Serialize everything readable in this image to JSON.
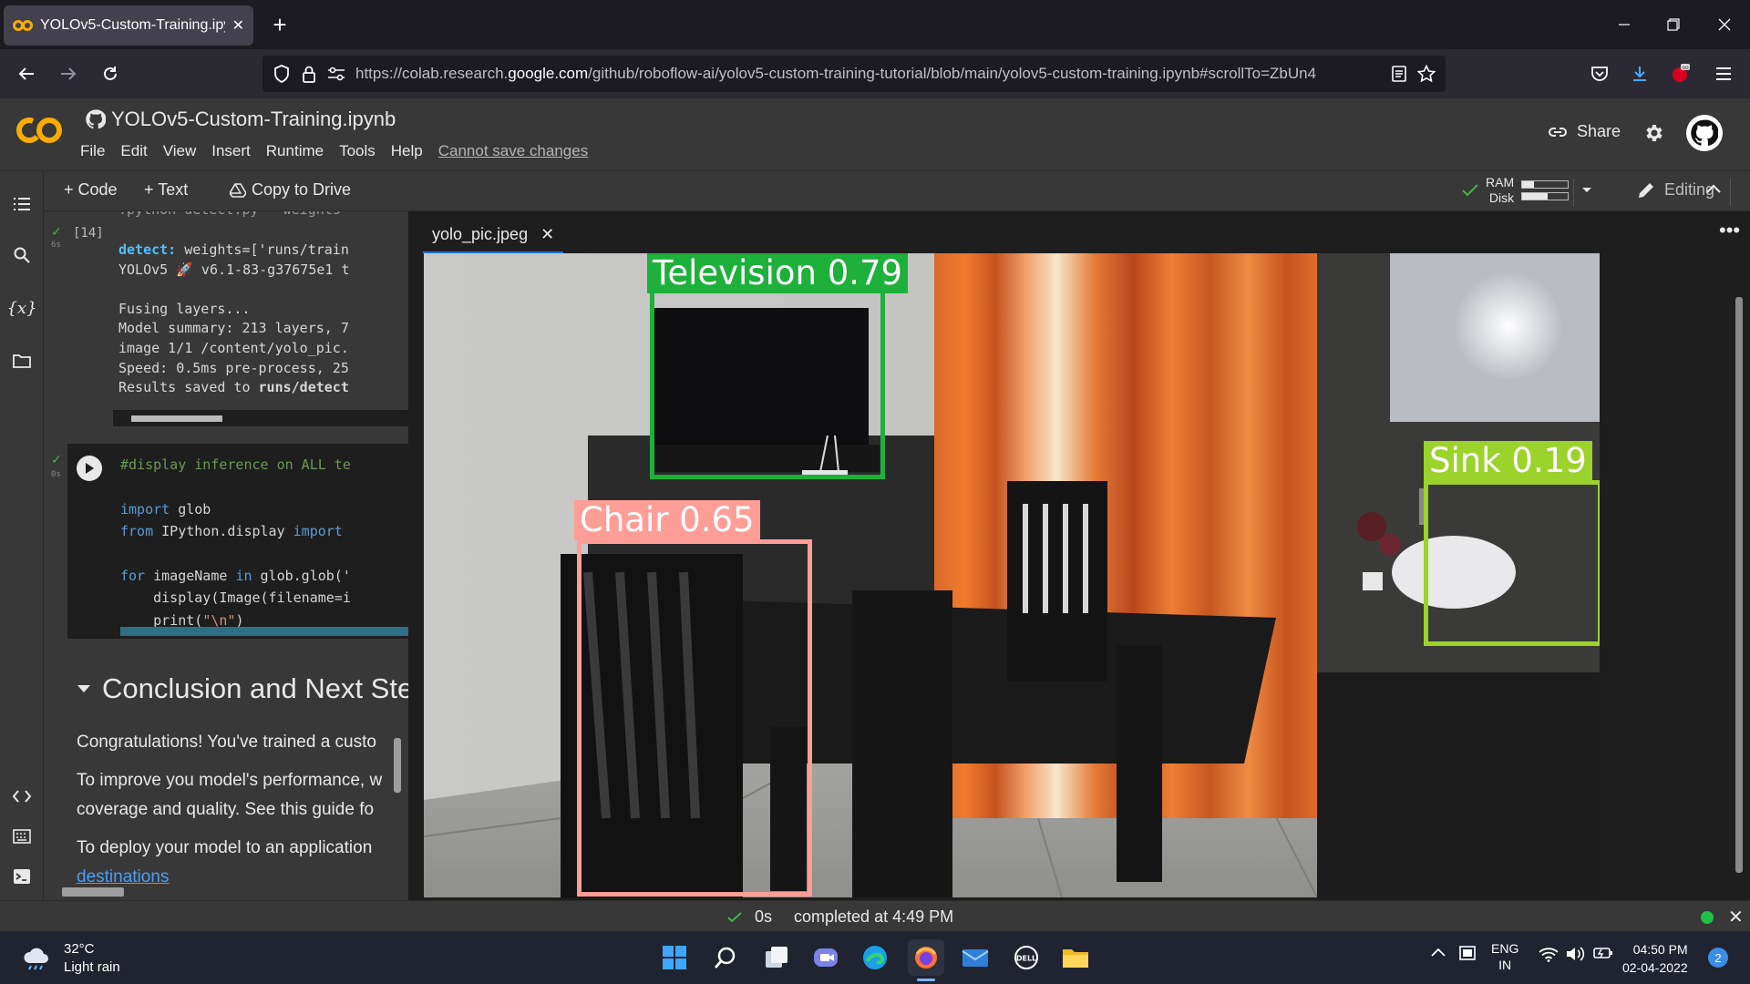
{
  "browser": {
    "tab_title": "YOLOv5-Custom-Training.ipynb",
    "url_prefix": "https://colab.research.",
    "url_domain": "google.com",
    "url_rest": "/github/roboflow-ai/yolov5-custom-training-tutorial/blob/main/yolov5-custom-training.ipynb#scrollTo=ZbUn4"
  },
  "colab": {
    "notebook_title": "YOLOv5-Custom-Training.ipynb",
    "menu": [
      "File",
      "Edit",
      "View",
      "Insert",
      "Runtime",
      "Tools",
      "Help"
    ],
    "cannot_save": "Cannot save changes",
    "share_label": "Share",
    "toolbar": {
      "code_label": "+ Code",
      "text_label": "+ Text",
      "copy_label": "Copy to Drive",
      "ram_label": "RAM",
      "disk_label": "Disk",
      "ram_fraction": 0.25,
      "disk_fraction": 0.55,
      "editing_label": "Editing"
    }
  },
  "notebook": {
    "cut_line": "!python detect.py --weights",
    "cell14_num": "[14]",
    "cell14_time": "6s",
    "output_lines": [
      "Fusing layers...",
      "Model summary: 213 layers, 7",
      "image 1/1 /content/yolo_pic.",
      "Speed: 0.5ms pre-process, 25"
    ],
    "detect_prefix": "detect: ",
    "detect_rest": "weights=['runs/train",
    "yolov5_line": "YOLOv5 🚀 v6.1-83-g37675e1 t",
    "results_prefix": "Results saved to ",
    "results_bold": "runs/detect",
    "cell2_time": "0s",
    "code_comment": "#display inference on ALL te",
    "code_import_kw": "import",
    "code_import_rest": " glob",
    "code_from_kw": "from",
    "code_from_mid": " IPython.display ",
    "code_from_import": "import",
    "code_for_kw": "for",
    "code_for_mid": " imageName ",
    "code_in_kw": "in",
    "code_for_rest": " glob.glob('",
    "code_display": "    display(Image(filename=i",
    "code_print_a": "    print(",
    "code_print_str": "\"\\n\"",
    "code_print_b": ")",
    "section_title": "Conclusion and Next Ste",
    "para1": "Congratulations! You've trained a custo",
    "para2a": "To improve you model's performance, w",
    "para2b": "coverage and quality. See this guide fo",
    "para3": "To deploy your model to an application",
    "para3_link": "destinations"
  },
  "viewer": {
    "tab_label": "yolo_pic.jpeg",
    "detections": [
      {
        "label": "Television 0.79",
        "color": "#1db03a"
      },
      {
        "label": "Chair 0.65",
        "color": "#ff9d97"
      },
      {
        "label": "Sink 0.19",
        "color": "#9bd22b"
      }
    ]
  },
  "status": {
    "duration": "0s",
    "text": "completed at 4:49 PM"
  },
  "taskbar": {
    "temp": "32°C",
    "weather": "Light rain",
    "lang1": "ENG",
    "lang2": "IN",
    "time": "04:50 PM",
    "date": "02-04-2022",
    "notif_count": "2"
  }
}
